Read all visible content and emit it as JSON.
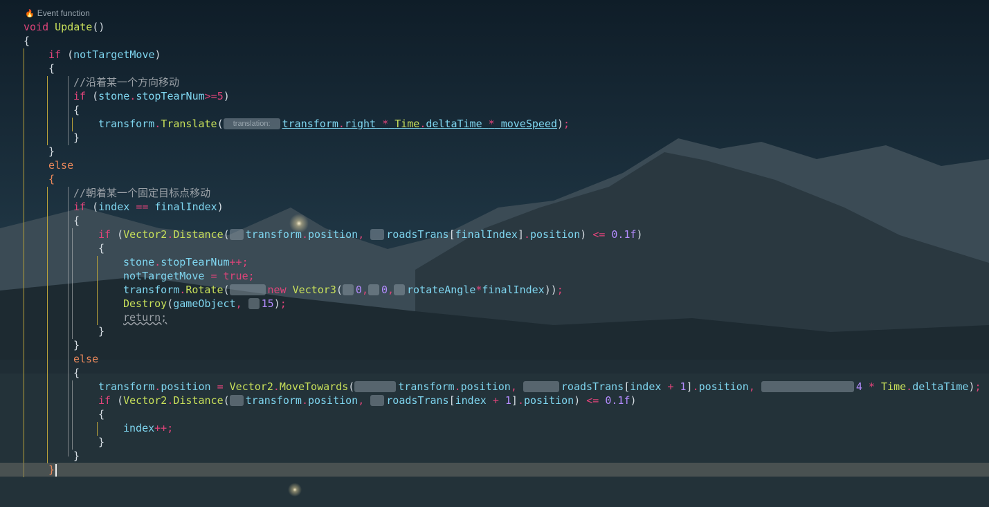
{
  "editor": {
    "hint_text": "Event function",
    "placeholder_labels": {
      "translation": "translation:"
    }
  },
  "code": {
    "void": "void",
    "update": "Update",
    "parens": "()",
    "if": "if",
    "else": "else",
    "not_target_move": "notTargetMove",
    "comment_1": "//沿着某一个方向移动",
    "comment_2": "//朝着某一个固定目标点移动",
    "stone": "stone",
    "stop_tear_num": "stopTearNum",
    "gte_5": ">=5",
    "transform": "transform",
    "translate": "Translate",
    "right": "right",
    "time": "Time",
    "delta_time": "deltaTime",
    "move_speed": "moveSpeed",
    "index": "index",
    "final_index": "finalIndex",
    "vector2": "Vector2",
    "distance": "Distance",
    "position": "position",
    "roads_trans": "roadsTrans",
    "threshold": "0.1f",
    "true": "true",
    "rotate": "Rotate",
    "new": "new",
    "vector3": "Vector3",
    "zero": "0",
    "rotate_angle": "rotateAngle",
    "destroy": "Destroy",
    "game_object": "gameObject",
    "fifteen": "15",
    "return": "return;",
    "move_towards": "MoveTowards",
    "one": "1",
    "four": "4"
  }
}
